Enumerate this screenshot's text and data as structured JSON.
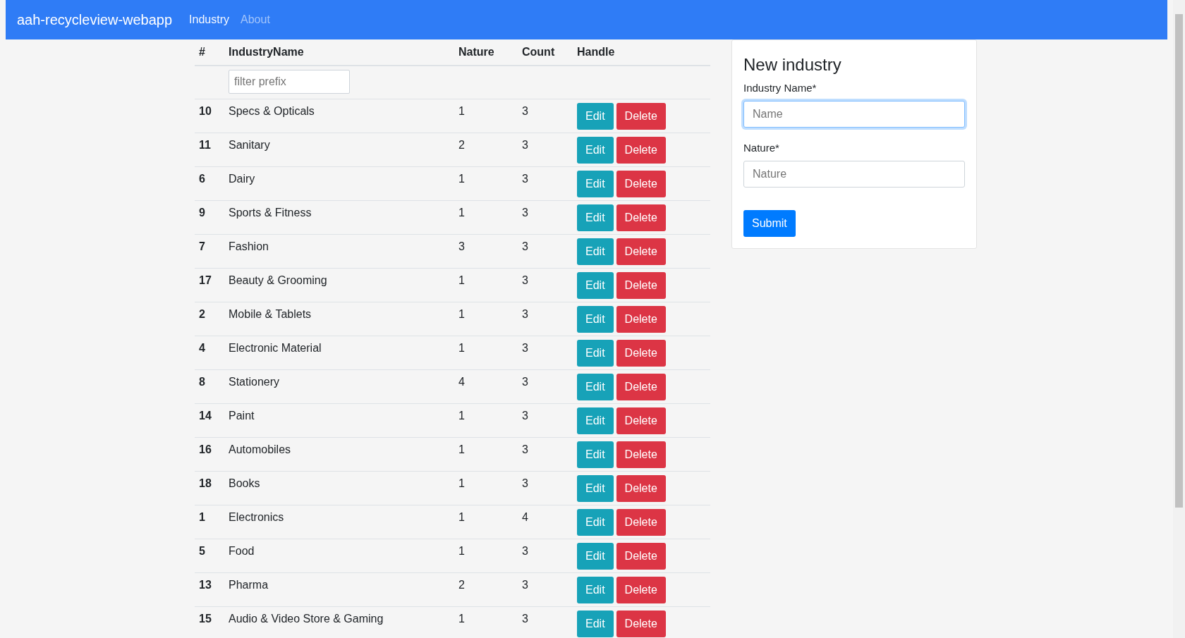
{
  "navbar": {
    "brand": "aah-recycleview-webapp",
    "links": [
      {
        "label": "Industry",
        "selected": true
      },
      {
        "label": "About",
        "selected": false
      }
    ]
  },
  "table": {
    "columns": [
      "#",
      "IndustryName",
      "Nature",
      "Count",
      "Handle"
    ],
    "filter": {
      "placeholder": "filter prefix"
    },
    "rows": [
      {
        "id": "10",
        "name": "Specs & Opticals",
        "nature": "1",
        "count": "3",
        "edit": "Edit",
        "delete": "Delete"
      },
      {
        "id": "11",
        "name": "Sanitary",
        "nature": "2",
        "count": "3",
        "edit": "Edit",
        "delete": "Delete"
      },
      {
        "id": "6",
        "name": "Dairy",
        "nature": "1",
        "count": "3",
        "edit": "Edit",
        "delete": "Delete"
      },
      {
        "id": "9",
        "name": "Sports & Fitness",
        "nature": "1",
        "count": "3",
        "edit": "Edit",
        "delete": "Delete"
      },
      {
        "id": "7",
        "name": "Fashion",
        "nature": "3",
        "count": "3",
        "edit": "Edit",
        "delete": "Delete"
      },
      {
        "id": "17",
        "name": "Beauty & Grooming",
        "nature": "1",
        "count": "3",
        "edit": "Edit",
        "delete": "Delete"
      },
      {
        "id": "2",
        "name": "Mobile & Tablets",
        "nature": "1",
        "count": "3",
        "edit": "Edit",
        "delete": "Delete"
      },
      {
        "id": "4",
        "name": "Electronic Material",
        "nature": "1",
        "count": "3",
        "edit": "Edit",
        "delete": "Delete"
      },
      {
        "id": "8",
        "name": "Stationery",
        "nature": "4",
        "count": "3",
        "edit": "Edit",
        "delete": "Delete"
      },
      {
        "id": "14",
        "name": "Paint",
        "nature": "1",
        "count": "3",
        "edit": "Edit",
        "delete": "Delete"
      },
      {
        "id": "16",
        "name": "Automobiles",
        "nature": "1",
        "count": "3",
        "edit": "Edit",
        "delete": "Delete"
      },
      {
        "id": "18",
        "name": "Books",
        "nature": "1",
        "count": "3",
        "edit": "Edit",
        "delete": "Delete"
      },
      {
        "id": "1",
        "name": "Electronics",
        "nature": "1",
        "count": "4",
        "edit": "Edit",
        "delete": "Delete"
      },
      {
        "id": "5",
        "name": "Food",
        "nature": "1",
        "count": "3",
        "edit": "Edit",
        "delete": "Delete"
      },
      {
        "id": "13",
        "name": "Pharma",
        "nature": "2",
        "count": "3",
        "edit": "Edit",
        "delete": "Delete"
      },
      {
        "id": "15",
        "name": "Audio & Video Store & Gaming",
        "nature": "1",
        "count": "3",
        "edit": "Edit",
        "delete": "Delete"
      }
    ]
  },
  "form": {
    "title": "New industry",
    "fields": [
      {
        "label": "Industry Name*",
        "placeholder": "Name",
        "focused": true
      },
      {
        "label": "Nature*",
        "placeholder": "Nature",
        "focused": false
      }
    ],
    "submit": "Submit"
  }
}
